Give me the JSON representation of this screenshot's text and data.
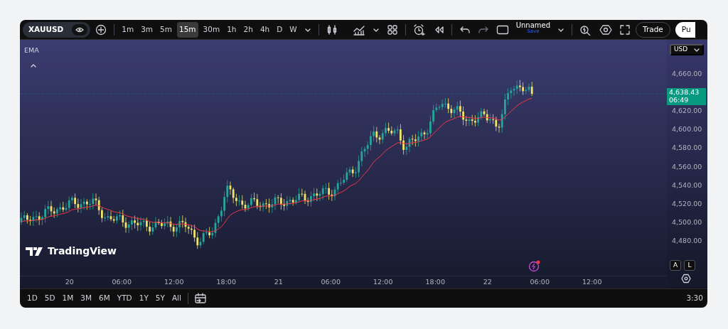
{
  "toolbar": {
    "symbol": "XAUUSD",
    "intervals": [
      {
        "label": "1m",
        "selected": false
      },
      {
        "label": "3m",
        "selected": false
      },
      {
        "label": "5m",
        "selected": false
      },
      {
        "label": "15m",
        "selected": true
      },
      {
        "label": "30m",
        "selected": false
      },
      {
        "label": "1h",
        "selected": false
      },
      {
        "label": "2h",
        "selected": false
      },
      {
        "label": "4h",
        "selected": false
      },
      {
        "label": "D",
        "selected": false
      },
      {
        "label": "W",
        "selected": false
      }
    ],
    "layout_name": "Unnamed",
    "save_label": "Save",
    "trade_button": "Trade",
    "publish_button": "Pu"
  },
  "chart": {
    "indicator": "EMA",
    "currency": "USD",
    "price_labels": [
      "4,660.00",
      "4,620.00",
      "4,600.00",
      "4,580.00",
      "4,560.00",
      "4,540.00",
      "4,520.00",
      "4,500.00",
      "4,480.00"
    ],
    "current_price": "4,638.43",
    "countdown": "06:49",
    "time_labels": [
      "20",
      "06:00",
      "12:00",
      "18:00",
      "21",
      "06:00",
      "12:00",
      "18:00",
      "22",
      "06:00",
      "12:00"
    ],
    "logo_text": "TradingView",
    "scale_buttons": [
      "A",
      "L"
    ]
  },
  "bottom_bar": {
    "ranges": [
      "1D",
      "5D",
      "1M",
      "3M",
      "6M",
      "YTD",
      "1Y",
      "5Y",
      "All"
    ],
    "time": "3:30"
  }
}
